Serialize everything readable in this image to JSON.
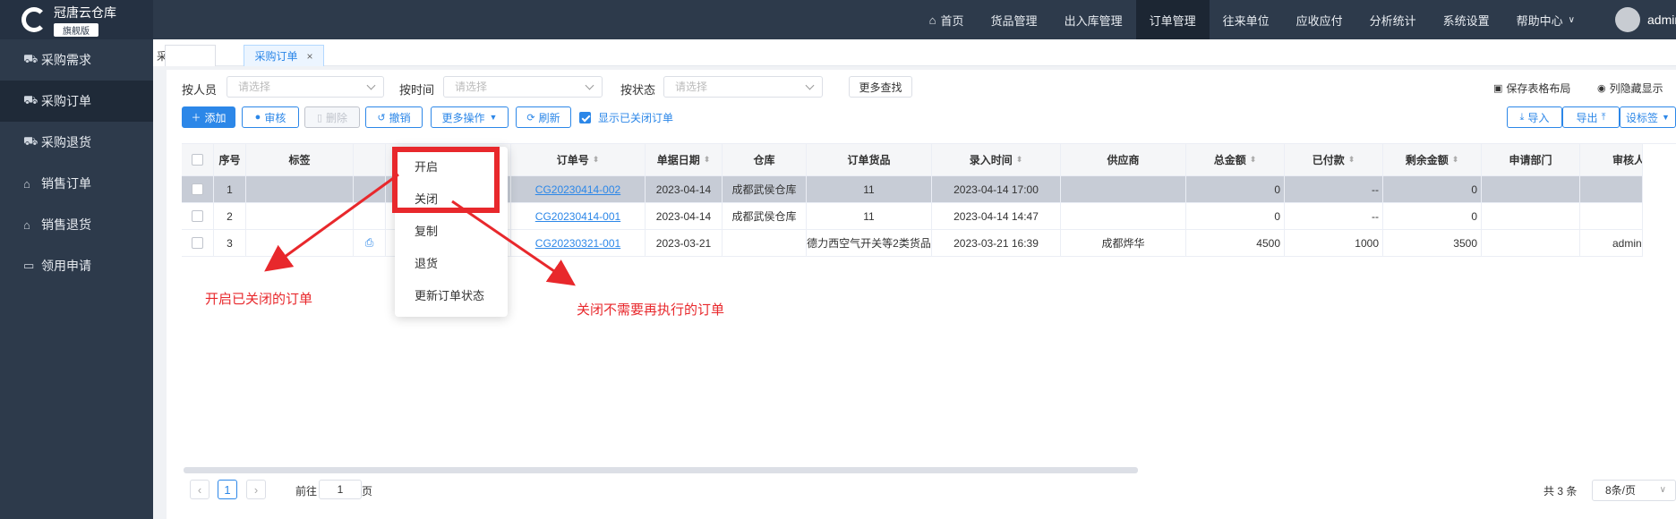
{
  "brand": {
    "title": "冠唐云仓库",
    "badge": "旗舰版"
  },
  "sidebar": {
    "items": [
      {
        "label": "采购需求",
        "icon": "cart-icon"
      },
      {
        "label": "采购订单",
        "icon": "cart-icon"
      },
      {
        "label": "采购退货",
        "icon": "cart-icon"
      },
      {
        "label": "销售订单",
        "icon": "bag-icon"
      },
      {
        "label": "销售退货",
        "icon": "bag-icon"
      },
      {
        "label": "领用申请",
        "icon": "briefcase-icon"
      }
    ]
  },
  "topnav": {
    "items": [
      "首页",
      "货品管理",
      "出入库管理",
      "订单管理",
      "往来单位",
      "应收应付",
      "分析统计",
      "系统设置",
      "帮助中心"
    ],
    "user": "admin"
  },
  "tabs": [
    {
      "label": "采购需求"
    },
    {
      "label": "采购订单"
    }
  ],
  "filters": {
    "person_label": "按人员",
    "person_placeholder": "请选择",
    "time_label": "按时间",
    "time_placeholder": "请选择",
    "status_label": "按状态",
    "status_placeholder": "请选择",
    "more_search": "更多查找"
  },
  "right_links": {
    "save_layout": "保存表格布局",
    "hide_columns": "列隐藏显示"
  },
  "toolbar": {
    "add": "添加",
    "approve": "审核",
    "delete": "删除",
    "revoke": "撤销",
    "more_ops": "更多操作",
    "refresh": "刷新",
    "show_closed": "显示已关闭订单",
    "import": "导入",
    "export": "导出",
    "set_label": "设标签"
  },
  "table": {
    "headers": [
      "序号",
      "标签",
      "",
      "",
      "订单号",
      "单据日期",
      "仓库",
      "订单货品",
      "录入时间",
      "供应商",
      "总金额",
      "已付款",
      "剩余金额",
      "申请部门",
      "审核人"
    ],
    "rows": [
      {
        "no": "1",
        "order": "CG20230414-002",
        "date": "2023-04-14",
        "warehouse": "成都武侯仓库",
        "goods": "11",
        "entry": "2023-04-14 17:00",
        "supplier": "",
        "total": "0",
        "paid": "--",
        "remain": "0",
        "dept": "",
        "reviewer": ""
      },
      {
        "no": "2",
        "order": "CG20230414-001",
        "date": "2023-04-14",
        "warehouse": "成都武侯仓库",
        "goods": "11",
        "entry": "2023-04-14 14:47",
        "supplier": "",
        "total": "0",
        "paid": "--",
        "remain": "0",
        "dept": "",
        "reviewer": ""
      },
      {
        "no": "3",
        "order": "CG20230321-001",
        "date": "2023-03-21",
        "warehouse": "",
        "goods": "德力西空气开关等2类货品",
        "entry": "2023-03-21 16:39",
        "supplier": "成都烨华",
        "total": "4500",
        "paid": "1000",
        "remain": "3500",
        "dept": "",
        "reviewer": "admin"
      }
    ]
  },
  "dropdown": {
    "items": [
      "开启",
      "关闭",
      "复制",
      "退货",
      "更新订单状态"
    ]
  },
  "annotations": {
    "left": "开启已关闭的订单",
    "right": "关闭不需要再执行的订单"
  },
  "pager": {
    "current": "1",
    "goto_label": "前往",
    "goto_value": "1",
    "page_suffix": "页",
    "total": "共 3 条",
    "page_size": "8条/页"
  },
  "colors": {
    "accent": "#2c87e8",
    "sidebar": "#2d3a4b",
    "annotation": "#e8282c"
  }
}
